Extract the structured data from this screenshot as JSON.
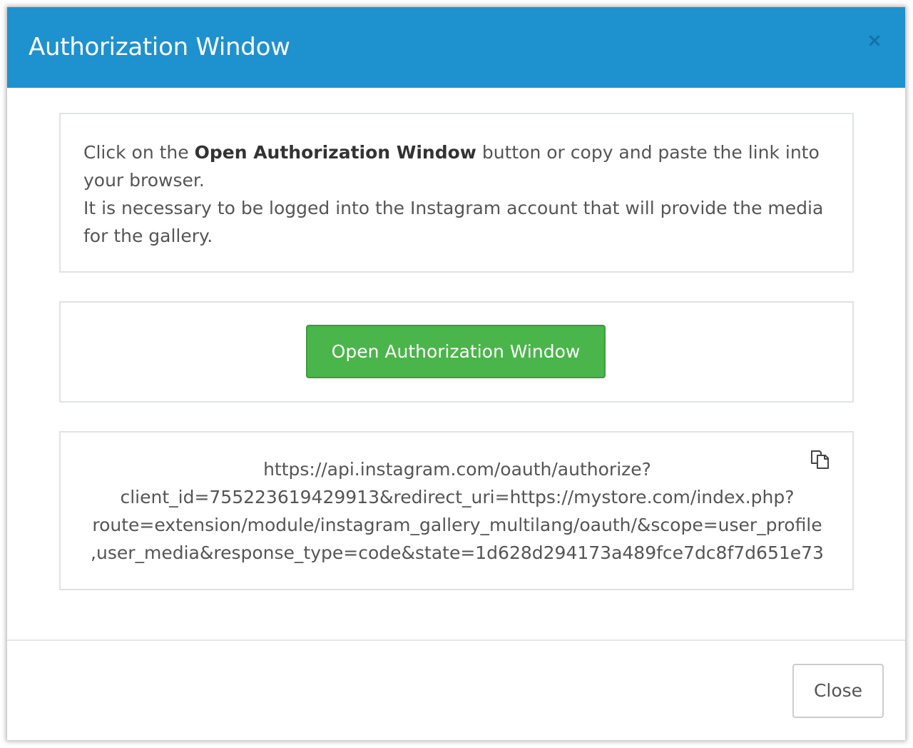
{
  "modal": {
    "title": "Authorization Window",
    "close_symbol": "×"
  },
  "info": {
    "line1_pre": "Click on the ",
    "line1_bold": "Open Authorization Window",
    "line1_post": " button or copy and paste the link into your browser.",
    "line2": "It is necessary to be logged into the Instagram account that will provide the media for the gallery."
  },
  "open_button_label": "Open Authorization Window",
  "auth_link": {
    "line1": "https://api.instagram.com/oauth/authorize?",
    "line2": "client_id=755223619429913&redirect_uri=https://mystore.com/index.php?",
    "line3": "route=extension/module/instagram_gallery_multilang/oauth/&scope=user_profile",
    "line4": ",user_media&response_type=code&state=1d628d294173a489fce7dc8f7d651e73"
  },
  "icons": {
    "close": "close-icon",
    "copy": "copy-icon"
  },
  "colors": {
    "header_bg": "#1e91cf",
    "primary_button": "#4ab54a"
  },
  "footer": {
    "close_label": "Close"
  }
}
